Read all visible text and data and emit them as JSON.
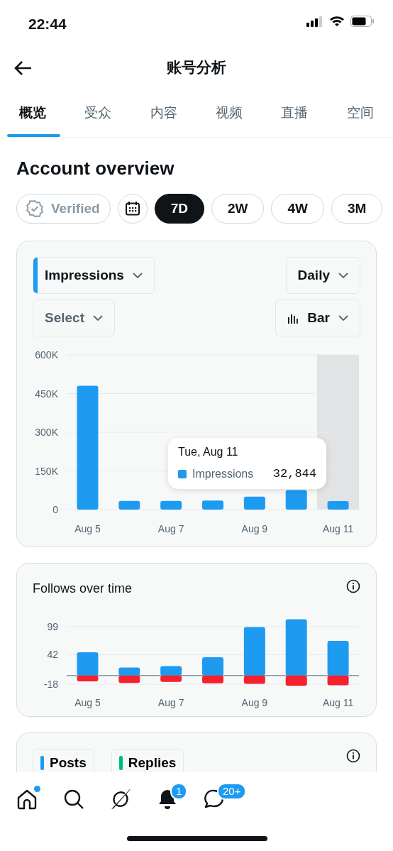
{
  "status_bar": {
    "time": "22:44"
  },
  "header": {
    "title": "账号分析"
  },
  "tabs": [
    {
      "label": "概览",
      "selected": true
    },
    {
      "label": "受众",
      "selected": false
    },
    {
      "label": "内容",
      "selected": false
    },
    {
      "label": "视频",
      "selected": false
    },
    {
      "label": "直播",
      "selected": false
    },
    {
      "label": "空间",
      "selected": false
    }
  ],
  "section_title": "Account overview",
  "filters": [
    {
      "kind": "verified",
      "label": "Verified",
      "selected": false
    },
    {
      "kind": "calendar",
      "selected": false
    },
    {
      "kind": "range",
      "label": "7D",
      "selected": true
    },
    {
      "kind": "range",
      "label": "2W",
      "selected": false
    },
    {
      "kind": "range",
      "label": "4W",
      "selected": false
    },
    {
      "kind": "range",
      "label": "3M",
      "selected": false
    }
  ],
  "impressions_card": {
    "metric_dropdown": {
      "label": "Impressions",
      "color": "#1d9bf0"
    },
    "interval_dropdown": {
      "label": "Daily"
    },
    "compare_dropdown": {
      "label": "Select"
    },
    "chart_type_dropdown": {
      "label": "Bar"
    },
    "tooltip": {
      "date": "Tue, Aug 11",
      "series": "Impressions",
      "value": "32,844",
      "color": "#1d9bf0"
    },
    "chart_data": {
      "type": "bar",
      "grid": true,
      "categories": [
        "Aug 5",
        null,
        "Aug 7",
        null,
        "Aug 9",
        null,
        "Aug 11"
      ],
      "ylim": [
        0,
        600000
      ],
      "yticks": [
        {
          "value": 0,
          "label": "0"
        },
        {
          "value": 150000,
          "label": "150K"
        },
        {
          "value": 300000,
          "label": "300K"
        },
        {
          "value": 450000,
          "label": "450K"
        },
        {
          "value": 600000,
          "label": "600K"
        }
      ],
      "series": [
        {
          "color": "#1d9bf0",
          "values": [
            480000,
            34000,
            34000,
            35000,
            50000,
            76000,
            32844
          ]
        }
      ]
    }
  },
  "follows_card": {
    "title": "Follows over time",
    "chart_data": {
      "type": "bar",
      "grid": true,
      "stacked": true,
      "categories": [
        "Aug 5",
        null,
        "Aug 7",
        null,
        "Aug 9",
        null,
        "Aug 11"
      ],
      "ylim": [
        -22,
        116
      ],
      "yticks": [
        -18,
        42,
        99
      ],
      "series": [
        {
          "color": "#1d9bf0",
          "values": [
            47,
            16,
            19,
            37,
            98,
            114,
            70
          ]
        },
        {
          "color": "#f4212e",
          "values": [
            -12,
            -15,
            -13,
            -16,
            -17,
            -21,
            -20
          ]
        }
      ]
    }
  },
  "content_card": {
    "legend": [
      {
        "label": "Posts",
        "color": "#1d9bf0"
      },
      {
        "label": "Replies",
        "color": "#00ba7c"
      }
    ]
  },
  "bottom_nav": [
    {
      "kind": "home",
      "dot": true
    },
    {
      "kind": "search"
    },
    {
      "kind": "explore"
    },
    {
      "kind": "notifications",
      "badge": "1"
    },
    {
      "kind": "messages",
      "badge": "20+"
    }
  ]
}
